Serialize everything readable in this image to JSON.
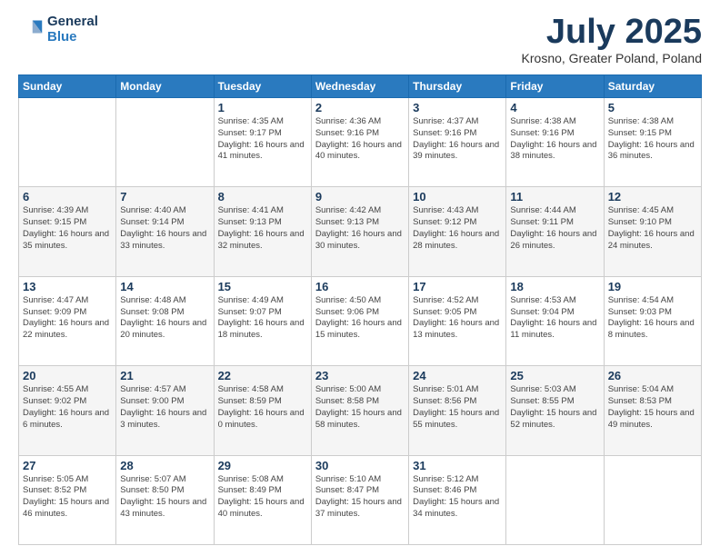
{
  "logo": {
    "line1": "General",
    "line2": "Blue"
  },
  "title": "July 2025",
  "subtitle": "Krosno, Greater Poland, Poland",
  "days": [
    "Sunday",
    "Monday",
    "Tuesday",
    "Wednesday",
    "Thursday",
    "Friday",
    "Saturday"
  ],
  "weeks": [
    [
      {
        "day": "",
        "info": ""
      },
      {
        "day": "",
        "info": ""
      },
      {
        "day": "1",
        "info": "Sunrise: 4:35 AM\nSunset: 9:17 PM\nDaylight: 16 hours\nand 41 minutes."
      },
      {
        "day": "2",
        "info": "Sunrise: 4:36 AM\nSunset: 9:16 PM\nDaylight: 16 hours\nand 40 minutes."
      },
      {
        "day": "3",
        "info": "Sunrise: 4:37 AM\nSunset: 9:16 PM\nDaylight: 16 hours\nand 39 minutes."
      },
      {
        "day": "4",
        "info": "Sunrise: 4:38 AM\nSunset: 9:16 PM\nDaylight: 16 hours\nand 38 minutes."
      },
      {
        "day": "5",
        "info": "Sunrise: 4:38 AM\nSunset: 9:15 PM\nDaylight: 16 hours\nand 36 minutes."
      }
    ],
    [
      {
        "day": "6",
        "info": "Sunrise: 4:39 AM\nSunset: 9:15 PM\nDaylight: 16 hours\nand 35 minutes."
      },
      {
        "day": "7",
        "info": "Sunrise: 4:40 AM\nSunset: 9:14 PM\nDaylight: 16 hours\nand 33 minutes."
      },
      {
        "day": "8",
        "info": "Sunrise: 4:41 AM\nSunset: 9:13 PM\nDaylight: 16 hours\nand 32 minutes."
      },
      {
        "day": "9",
        "info": "Sunrise: 4:42 AM\nSunset: 9:13 PM\nDaylight: 16 hours\nand 30 minutes."
      },
      {
        "day": "10",
        "info": "Sunrise: 4:43 AM\nSunset: 9:12 PM\nDaylight: 16 hours\nand 28 minutes."
      },
      {
        "day": "11",
        "info": "Sunrise: 4:44 AM\nSunset: 9:11 PM\nDaylight: 16 hours\nand 26 minutes."
      },
      {
        "day": "12",
        "info": "Sunrise: 4:45 AM\nSunset: 9:10 PM\nDaylight: 16 hours\nand 24 minutes."
      }
    ],
    [
      {
        "day": "13",
        "info": "Sunrise: 4:47 AM\nSunset: 9:09 PM\nDaylight: 16 hours\nand 22 minutes."
      },
      {
        "day": "14",
        "info": "Sunrise: 4:48 AM\nSunset: 9:08 PM\nDaylight: 16 hours\nand 20 minutes."
      },
      {
        "day": "15",
        "info": "Sunrise: 4:49 AM\nSunset: 9:07 PM\nDaylight: 16 hours\nand 18 minutes."
      },
      {
        "day": "16",
        "info": "Sunrise: 4:50 AM\nSunset: 9:06 PM\nDaylight: 16 hours\nand 15 minutes."
      },
      {
        "day": "17",
        "info": "Sunrise: 4:52 AM\nSunset: 9:05 PM\nDaylight: 16 hours\nand 13 minutes."
      },
      {
        "day": "18",
        "info": "Sunrise: 4:53 AM\nSunset: 9:04 PM\nDaylight: 16 hours\nand 11 minutes."
      },
      {
        "day": "19",
        "info": "Sunrise: 4:54 AM\nSunset: 9:03 PM\nDaylight: 16 hours\nand 8 minutes."
      }
    ],
    [
      {
        "day": "20",
        "info": "Sunrise: 4:55 AM\nSunset: 9:02 PM\nDaylight: 16 hours\nand 6 minutes."
      },
      {
        "day": "21",
        "info": "Sunrise: 4:57 AM\nSunset: 9:00 PM\nDaylight: 16 hours\nand 3 minutes."
      },
      {
        "day": "22",
        "info": "Sunrise: 4:58 AM\nSunset: 8:59 PM\nDaylight: 16 hours\nand 0 minutes."
      },
      {
        "day": "23",
        "info": "Sunrise: 5:00 AM\nSunset: 8:58 PM\nDaylight: 15 hours\nand 58 minutes."
      },
      {
        "day": "24",
        "info": "Sunrise: 5:01 AM\nSunset: 8:56 PM\nDaylight: 15 hours\nand 55 minutes."
      },
      {
        "day": "25",
        "info": "Sunrise: 5:03 AM\nSunset: 8:55 PM\nDaylight: 15 hours\nand 52 minutes."
      },
      {
        "day": "26",
        "info": "Sunrise: 5:04 AM\nSunset: 8:53 PM\nDaylight: 15 hours\nand 49 minutes."
      }
    ],
    [
      {
        "day": "27",
        "info": "Sunrise: 5:05 AM\nSunset: 8:52 PM\nDaylight: 15 hours\nand 46 minutes."
      },
      {
        "day": "28",
        "info": "Sunrise: 5:07 AM\nSunset: 8:50 PM\nDaylight: 15 hours\nand 43 minutes."
      },
      {
        "day": "29",
        "info": "Sunrise: 5:08 AM\nSunset: 8:49 PM\nDaylight: 15 hours\nand 40 minutes."
      },
      {
        "day": "30",
        "info": "Sunrise: 5:10 AM\nSunset: 8:47 PM\nDaylight: 15 hours\nand 37 minutes."
      },
      {
        "day": "31",
        "info": "Sunrise: 5:12 AM\nSunset: 8:46 PM\nDaylight: 15 hours\nand 34 minutes."
      },
      {
        "day": "",
        "info": ""
      },
      {
        "day": "",
        "info": ""
      }
    ]
  ]
}
